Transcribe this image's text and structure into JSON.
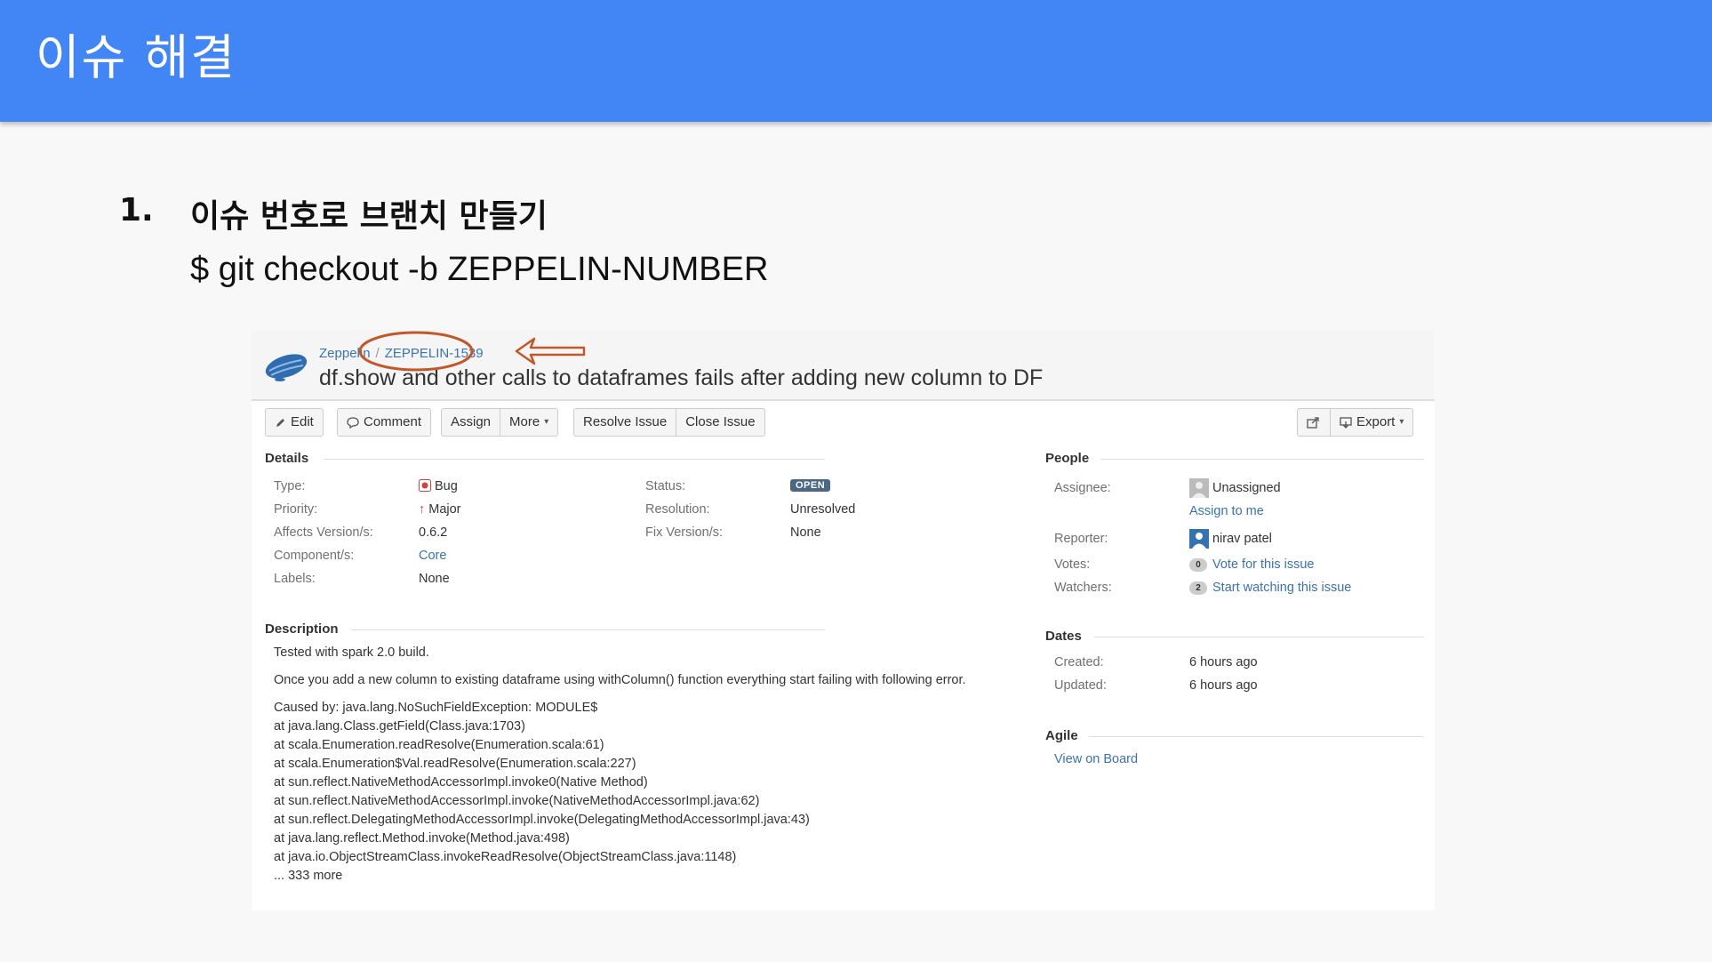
{
  "slide": {
    "title": "이슈 해결",
    "step_number": "1.",
    "step_title": "이슈 번호로 브랜치 만들기",
    "command": "$ git checkout -b ZEPPELIN-NUMBER",
    "header_color": "#4285f4"
  },
  "issue": {
    "project": "Zeppelin",
    "key": "ZEPPELIN-1539",
    "summary": "df.show and other calls to dataframes fails after adding new column to DF"
  },
  "toolbar": {
    "edit": "Edit",
    "comment": "Comment",
    "assign": "Assign",
    "more": "More",
    "resolve": "Resolve Issue",
    "close": "Close Issue",
    "export": "Export"
  },
  "details": {
    "heading": "Details",
    "type_label": "Type:",
    "type_value": "Bug",
    "priority_label": "Priority:",
    "priority_value": "Major",
    "affects_label": "Affects Version/s:",
    "affects_value": "0.6.2",
    "component_label": "Component/s:",
    "component_value": "Core",
    "labels_label": "Labels:",
    "labels_value": "None",
    "status_label": "Status:",
    "status_value": "OPEN",
    "resolution_label": "Resolution:",
    "resolution_value": "Unresolved",
    "fix_label": "Fix Version/s:",
    "fix_value": "None"
  },
  "description": {
    "heading": "Description",
    "line1": "Tested with spark 2.0 build.",
    "line2": "Once you add a new column to existing dataframe using withColumn() function everything start failing with following error.",
    "trace": [
      "Caused by: java.lang.NoSuchFieldException: MODULE$",
      "at java.lang.Class.getField(Class.java:1703)",
      "at scala.Enumeration.readResolve(Enumeration.scala:61)",
      "at scala.Enumeration$Val.readResolve(Enumeration.scala:227)",
      "at sun.reflect.NativeMethodAccessorImpl.invoke0(Native Method)",
      "at sun.reflect.NativeMethodAccessorImpl.invoke(NativeMethodAccessorImpl.java:62)",
      "at sun.reflect.DelegatingMethodAccessorImpl.invoke(DelegatingMethodAccessorImpl.java:43)",
      "at java.lang.reflect.Method.invoke(Method.java:498)",
      "at java.io.ObjectStreamClass.invokeReadResolve(ObjectStreamClass.java:1148)",
      "... 333 more"
    ]
  },
  "people": {
    "heading": "People",
    "assignee_label": "Assignee:",
    "assignee_value": "Unassigned",
    "assign_to_me": "Assign to me",
    "reporter_label": "Reporter:",
    "reporter_value": "nirav patel",
    "votes_label": "Votes:",
    "votes_count": "0",
    "votes_link": "Vote for this issue",
    "watchers_label": "Watchers:",
    "watchers_count": "2",
    "watchers_link": "Start watching this issue"
  },
  "dates": {
    "heading": "Dates",
    "created_label": "Created:",
    "created_value": "6 hours ago",
    "updated_label": "Updated:",
    "updated_value": "6 hours ago"
  },
  "agile": {
    "heading": "Agile",
    "view_on_board": "View on Board"
  },
  "annotation_color": "#c0582a"
}
